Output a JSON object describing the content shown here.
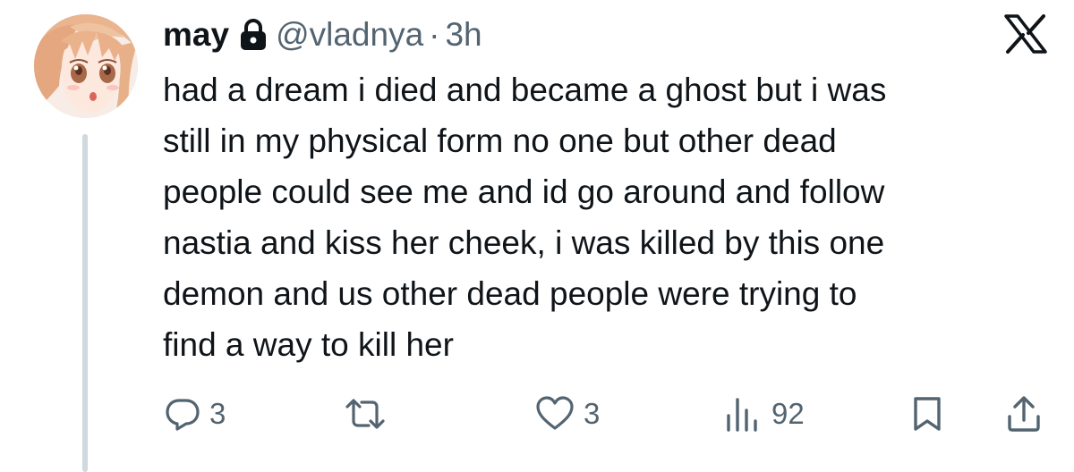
{
  "author": {
    "display_name": "may",
    "handle": "@vladnya",
    "separator": "·",
    "time": "3h",
    "protected_icon": "lock-icon",
    "avatar_icon": "anime-avatar"
  },
  "platform_icon": "x-logo-icon",
  "tweet": {
    "lines": [
      "had a dream i died and became a ghost but i was",
      "still in my physical form no one but other dead",
      "people could see me and id go around and follow",
      "nastia and kiss her cheek, i was killed by this one",
      "demon and us other dead people were trying to",
      "find a way to kill her"
    ]
  },
  "actions": {
    "reply": {
      "icon": "reply-icon",
      "count": "3"
    },
    "repost": {
      "icon": "repost-icon",
      "count": ""
    },
    "like": {
      "icon": "heart-icon",
      "count": "3"
    },
    "views": {
      "icon": "views-icon",
      "count": "92"
    },
    "bookmark": {
      "icon": "bookmark-icon"
    },
    "share": {
      "icon": "share-icon"
    }
  },
  "colors": {
    "text": "#0f1419",
    "secondary": "#536471",
    "thread_line": "#cfd9de",
    "background": "#ffffff"
  }
}
